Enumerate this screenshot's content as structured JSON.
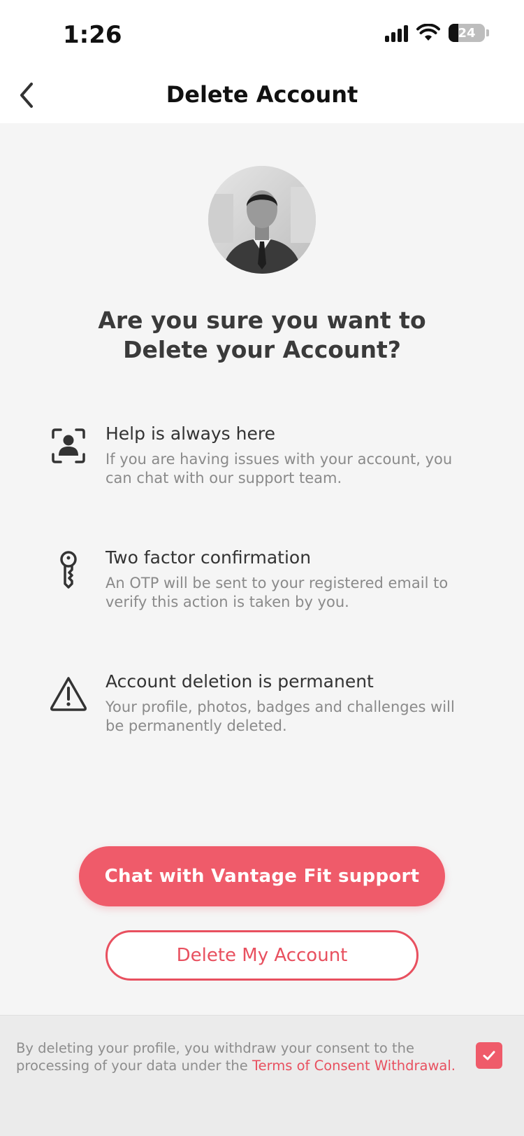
{
  "status_bar": {
    "time": "1:26",
    "battery": "24",
    "icons": [
      "signal-icon",
      "wifi-icon",
      "battery-icon"
    ]
  },
  "header": {
    "title": "Delete Account",
    "back_icon": "chevron-left-icon"
  },
  "main": {
    "question": "Are you sure you want to Delete your Account?",
    "items": [
      {
        "icon": "support-person-icon",
        "title": "Help is always here",
        "description": "If you are having issues with your account, you can chat with our support team."
      },
      {
        "icon": "key-icon",
        "title": "Two factor confirmation",
        "description": "An OTP will be sent to your registered email to verify this action is taken by you."
      },
      {
        "icon": "warning-icon",
        "title": "Account deletion is permanent",
        "description": "Your profile, photos, badges and challenges will be permanently deleted."
      }
    ],
    "chat_button": "Chat with Vantage Fit support",
    "delete_button": "Delete My Account"
  },
  "footer": {
    "consent_text": "By deleting your profile, you withdraw your consent to the processing of your data under the ",
    "consent_link": "Terms of Consent Withdrawal.",
    "checkbox_checked": true
  },
  "colors": {
    "accent": "#ef5b6a",
    "accent_text": "#e8505f"
  }
}
